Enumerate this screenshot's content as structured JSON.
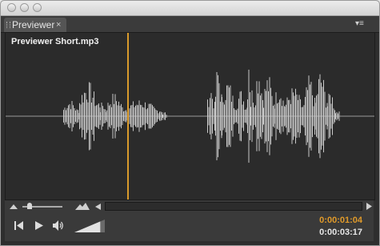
{
  "window": {
    "title": ""
  },
  "tab": {
    "label": "Previewer",
    "close_glyph": "×"
  },
  "panel_menu": {
    "icon": "panel-menu-icon",
    "glyph": "▾≡"
  },
  "file": {
    "name": "Previewer Short.mp3"
  },
  "zoom": {
    "level": 0.12,
    "icons": [
      "zoom-out-mountain-icon",
      "zoom-in-mountain-icon"
    ]
  },
  "transport": {
    "icons": [
      "go-to-start-icon",
      "play-icon",
      "volume-icon",
      "volume-slider-icon"
    ],
    "volume_level": 0.85
  },
  "time": {
    "current": "0:00:01:04",
    "duration": "0:00:03:17",
    "current_color": "#e09a2a",
    "duration_color": "#e6e6e6"
  },
  "playback": {
    "playhead_position": 0.33
  },
  "colors": {
    "waveform": "#c9c9c9",
    "playhead": "#d99a2b",
    "background": "#2b2b2b"
  }
}
